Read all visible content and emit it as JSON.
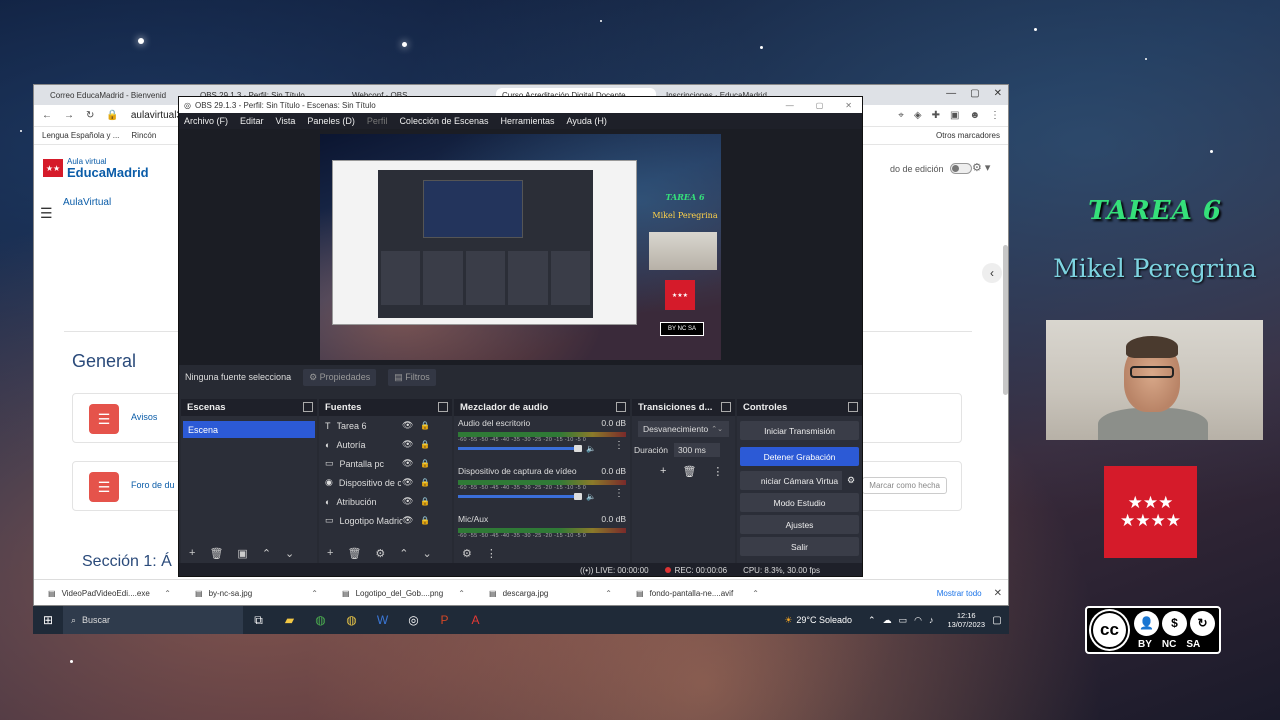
{
  "overlay": {
    "title": "TAREA 6",
    "name": "Mikel Peregrina",
    "madrid_flag": "★★★\n★★★★",
    "cc_badge": {
      "cc": "cc",
      "labels": [
        "BY",
        "NC",
        "SA"
      ]
    }
  },
  "browser": {
    "tabs": [
      {
        "label": "Correo EducaMadrid - Bienvenid",
        "active": false
      },
      {
        "label": "OBS 29.1.3 · Perfil: Sin Título",
        "active": false
      },
      {
        "label": "Webconf · OBS",
        "active": false
      },
      {
        "label": "Curso Acreditación Digital Docente",
        "active": true
      },
      {
        "label": "Inscripciones · EducaMadrid",
        "active": false
      }
    ],
    "url": "aulavirtual32.educa.madrid.org",
    "bookmarks": [
      "Lengua Española y ...",
      "Rincón"
    ],
    "bookmarks_right": "Otros marcadores",
    "extensions": [
      "⌖",
      "◈",
      "✚",
      "▣",
      "☻",
      "⋮"
    ]
  },
  "moodle": {
    "logo_small": "Aula virtual",
    "logo_big": "EducaMadrid",
    "flag": "★★",
    "breadcrumb": "AulaVirtual",
    "edit_mode": "do de edición",
    "general_heading": "General",
    "activities": [
      {
        "label": "Avisos"
      },
      {
        "label": "Foro de du",
        "mark": "Marcar como hecha"
      }
    ],
    "section_heading": "Sección 1: Á"
  },
  "downloads": {
    "items": [
      {
        "name": "VideoPadVideoEdi....exe"
      },
      {
        "name": "by-nc-sa.jpg"
      },
      {
        "name": "Logotipo_del_Gob....png"
      },
      {
        "name": "descarga.jpg"
      },
      {
        "name": "fondo-pantalla-ne....avif"
      }
    ],
    "show_all": "Mostrar todo",
    "close": "✕"
  },
  "taskbar": {
    "search": "Buscar",
    "weather": "29°C Soleado",
    "time": "12:16",
    "date": "13/07/2023"
  },
  "obs": {
    "title": "OBS 29.1.3 - Perfil: Sin Título - Escenas: Sin Título",
    "menu": [
      {
        "label": "Archivo (F)",
        "dim": false
      },
      {
        "label": "Editar",
        "dim": false
      },
      {
        "label": "Vista",
        "dim": false
      },
      {
        "label": "Paneles (D)",
        "dim": false
      },
      {
        "label": "Perfil",
        "dim": true
      },
      {
        "label": "Colección de Escenas",
        "dim": false
      },
      {
        "label": "Herramientas",
        "dim": false
      },
      {
        "label": "Ayuda (H)",
        "dim": false
      }
    ],
    "preview": {
      "title": "TAREA 6",
      "name": "Mikel Peregrina",
      "flag": "★★★",
      "cc": "BY NC SA"
    },
    "no_source": "Ninguna fuente selecciona",
    "properties": "Propiedades",
    "filters": "Filtros",
    "docks": {
      "scenes": {
        "title": "Escenas",
        "items": [
          "Escena"
        ]
      },
      "sources": {
        "title": "Fuentes",
        "items": [
          {
            "name": "Tarea 6",
            "icon": "T"
          },
          {
            "name": "Autoría",
            "icon": "◐"
          },
          {
            "name": "Pantalla pc",
            "icon": "▭"
          },
          {
            "name": "Dispositivo de c",
            "icon": "◉"
          },
          {
            "name": "Atribución",
            "icon": "◐"
          },
          {
            "name": "Logotipo Madric",
            "icon": "▭"
          }
        ]
      },
      "mixer": {
        "title": "Mezclador de audio",
        "scale": "-60 -55 -50 -45 -40 -35 -30 -25 -20 -15 -10 -5 0",
        "channels": [
          {
            "name": "Audio del escritorio",
            "db": "0.0 dB"
          },
          {
            "name": "Dispositivo de captura de vídeo",
            "db": "0.0 dB"
          },
          {
            "name": "Mic/Aux",
            "db": "0.0 dB"
          }
        ]
      },
      "transitions": {
        "title": "Transiciones d...",
        "type": "Desvanecimiento",
        "duration_label": "Duración",
        "duration_value": "300 ms"
      },
      "controls": {
        "title": "Controles",
        "buttons": [
          {
            "label": "Iniciar Transmisión",
            "active": false
          },
          {
            "label": "Detener Grabación",
            "active": true
          },
          {
            "label": "niciar Cámara Virtua",
            "active": false
          },
          {
            "label": "Modo Estudio",
            "active": false
          },
          {
            "label": "Ajustes",
            "active": false
          },
          {
            "label": "Salir",
            "active": false
          }
        ]
      }
    },
    "status": {
      "live": "LIVE: 00:00:00",
      "rec": "REC: 00:00:06",
      "cpu": "CPU: 8.3%, 30.00 fps"
    }
  },
  "colors": {
    "accent_blue": "#2c5ad6",
    "tarea_green": "#35e07a",
    "madrid_red": "#d51b2a"
  }
}
